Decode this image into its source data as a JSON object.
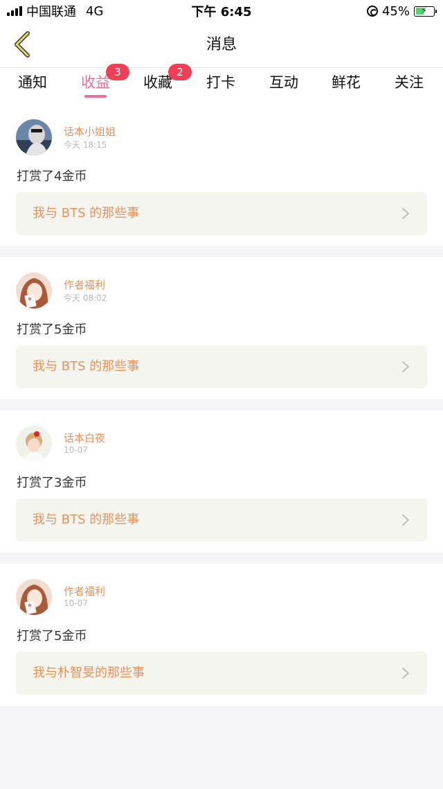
{
  "status_bar": {
    "carrier": "中国联通",
    "network": "4G",
    "time": "下午 6:45",
    "battery": "45%",
    "battery_level": 0.45
  },
  "header": {
    "title": "消息"
  },
  "tabs": [
    {
      "label": "通知",
      "badge": ""
    },
    {
      "label": "收益",
      "badge": "3",
      "active": true
    },
    {
      "label": "收藏",
      "badge": "2"
    },
    {
      "label": "打卡",
      "badge": ""
    },
    {
      "label": "互动",
      "badge": ""
    },
    {
      "label": "鲜花",
      "badge": ""
    },
    {
      "label": "关注",
      "badge": ""
    }
  ],
  "messages": [
    {
      "user": "话本小姐姐",
      "time": "今天 18:15",
      "action": "打赏了4金币",
      "book": "我与 BTS 的那些事"
    },
    {
      "user": "作者福利",
      "time": "今天 08:02",
      "action": "打赏了5金币",
      "book": "我与 BTS 的那些事"
    },
    {
      "user": "话本白夜",
      "time": "10-07",
      "action": "打赏了3金币",
      "book": "我与 BTS 的那些事"
    },
    {
      "user": "作者福利",
      "time": "10-07",
      "action": "打赏了5金币",
      "book": "我与朴智旻的那些事"
    }
  ],
  "colors": {
    "accent": "#e8709a",
    "name": "#e7925a",
    "badge": "#f03e56",
    "back_arrow": "#e6d86a"
  }
}
